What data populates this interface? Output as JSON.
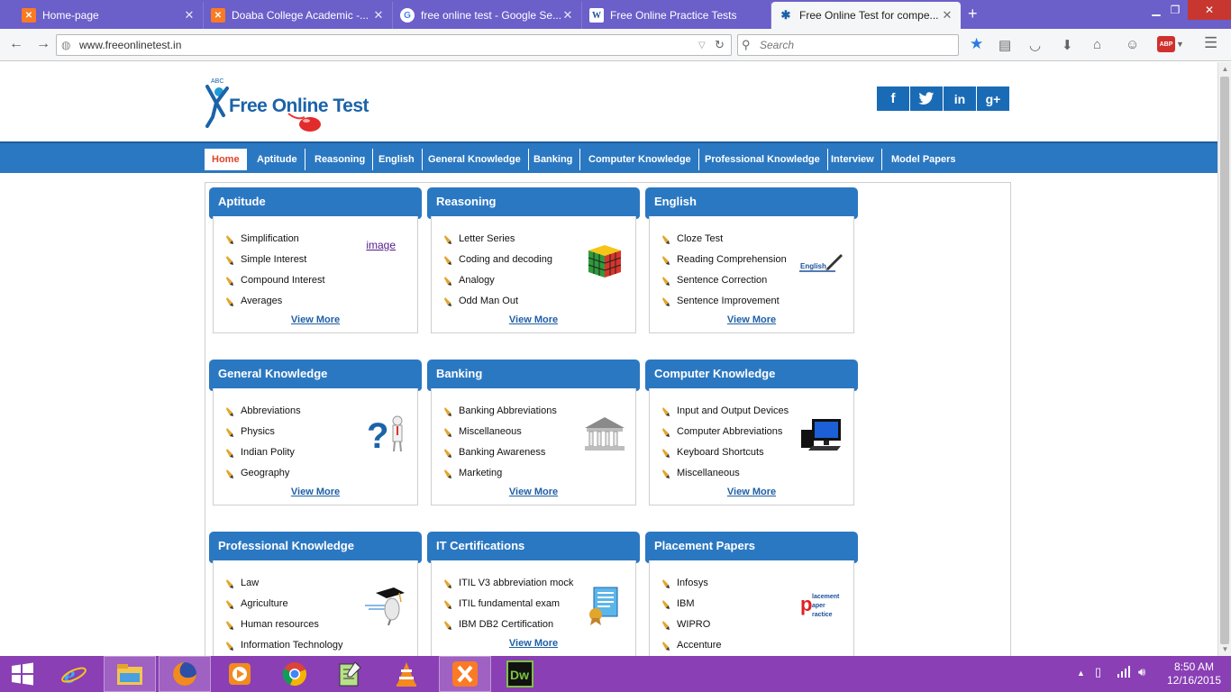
{
  "browser": {
    "tabs": [
      {
        "title": "Home-page",
        "icon": "xampp-icon",
        "active": false
      },
      {
        "title": "Doaba College Academic -...",
        "icon": "xampp-icon",
        "active": false
      },
      {
        "title": "free online test - Google Se...",
        "icon": "google-icon",
        "active": false
      },
      {
        "title": "Free Online Practice Tests",
        "icon": "wikipedia-icon",
        "active": false
      },
      {
        "title": "Free Online Test for compe...",
        "icon": "site-icon",
        "active": true
      }
    ],
    "url": "www.freeonlinetest.in",
    "search_placeholder": "Search"
  },
  "site": {
    "logo_text": "Free Online Test",
    "social": [
      "f",
      "t",
      "in",
      "g+"
    ],
    "menu": [
      "Home",
      "Aptitude",
      "Reasoning",
      "English",
      "General Knowledge",
      "Banking",
      "Computer Knowledge",
      "Professional Knowledge",
      "Interview",
      "Model Papers"
    ],
    "view_more": "View More",
    "image_link": "image",
    "sections": [
      {
        "title": "Aptitude",
        "items": [
          "Simplification",
          "Simple Interest",
          "Compound Interest",
          "Averages"
        ]
      },
      {
        "title": "Reasoning",
        "items": [
          "Letter Series",
          "Coding and decoding",
          "Analogy",
          "Odd Man Out"
        ]
      },
      {
        "title": "English",
        "items": [
          "Cloze Test",
          "Reading Comprehension",
          "Sentence Correction",
          "Sentence Improvement"
        ]
      },
      {
        "title": "General Knowledge",
        "items": [
          "Abbreviations",
          "Physics",
          "Indian Polity",
          "Geography"
        ]
      },
      {
        "title": "Banking",
        "items": [
          "Banking Abbreviations",
          "Miscellaneous",
          "Banking Awareness",
          "Marketing"
        ]
      },
      {
        "title": "Computer Knowledge",
        "items": [
          "Input and Output Devices",
          "Computer Abbreviations",
          "Keyboard Shortcuts",
          "Miscellaneous"
        ]
      },
      {
        "title": "Professional Knowledge",
        "items": [
          "Law",
          "Agriculture",
          "Human resources",
          "Information Technology"
        ]
      },
      {
        "title": "IT Certifications",
        "items": [
          "ITIL V3 abbreviation mock",
          "ITIL fundamental exam",
          "IBM DB2 Certification"
        ]
      },
      {
        "title": "Placement Papers",
        "items": [
          "Infosys",
          "IBM",
          "WIPRO",
          "Accenture"
        ]
      }
    ],
    "english_badge": "English",
    "placement_badge": [
      "lacement",
      "aper",
      "ractice"
    ]
  },
  "taskbar": {
    "time": "8:50 AM",
    "date": "12/16/2015",
    "dw_label": "Dw"
  }
}
